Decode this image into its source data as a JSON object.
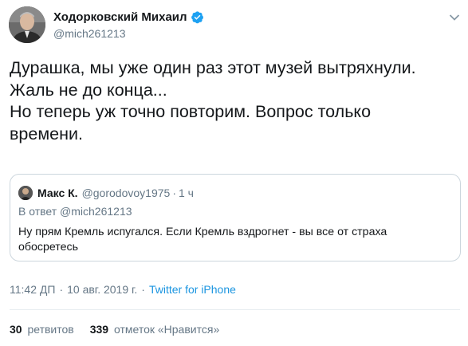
{
  "author": {
    "name": "Ходорковский Михаил",
    "handle": "@mich261213",
    "verified": true
  },
  "tweet": {
    "text": "Дурашка, мы уже один раз этот музей вытряхнули.\nЖаль не до конца...\nНо теперь уж точно повторим. Вопрос только\nвремени."
  },
  "quote": {
    "name": "Макс К.",
    "handle": "@gorodovoy1975",
    "dot": "·",
    "time": "1 ч",
    "reply_prefix": "В ответ",
    "reply_handle": "@mich261213",
    "text": "Ну прям Кремль испугался. Если Кремль вздрогнет - вы все от страха обосретесь"
  },
  "meta": {
    "time": "11:42 ДП",
    "sep1": "·",
    "date": "10 авг. 2019 г.",
    "sep2": "·",
    "source": "Twitter for iPhone"
  },
  "stats": {
    "retweets_count": "30",
    "retweets_label": "ретвитов",
    "likes_count": "339",
    "likes_label": "отметок «Нравится»"
  },
  "colors": {
    "link": "#1b95e0",
    "secondary": "#657786",
    "border": "#ccd6dd",
    "verified": "#1da1f2"
  },
  "icons": [
    "verified-badge-icon",
    "chevron-down-icon"
  ]
}
